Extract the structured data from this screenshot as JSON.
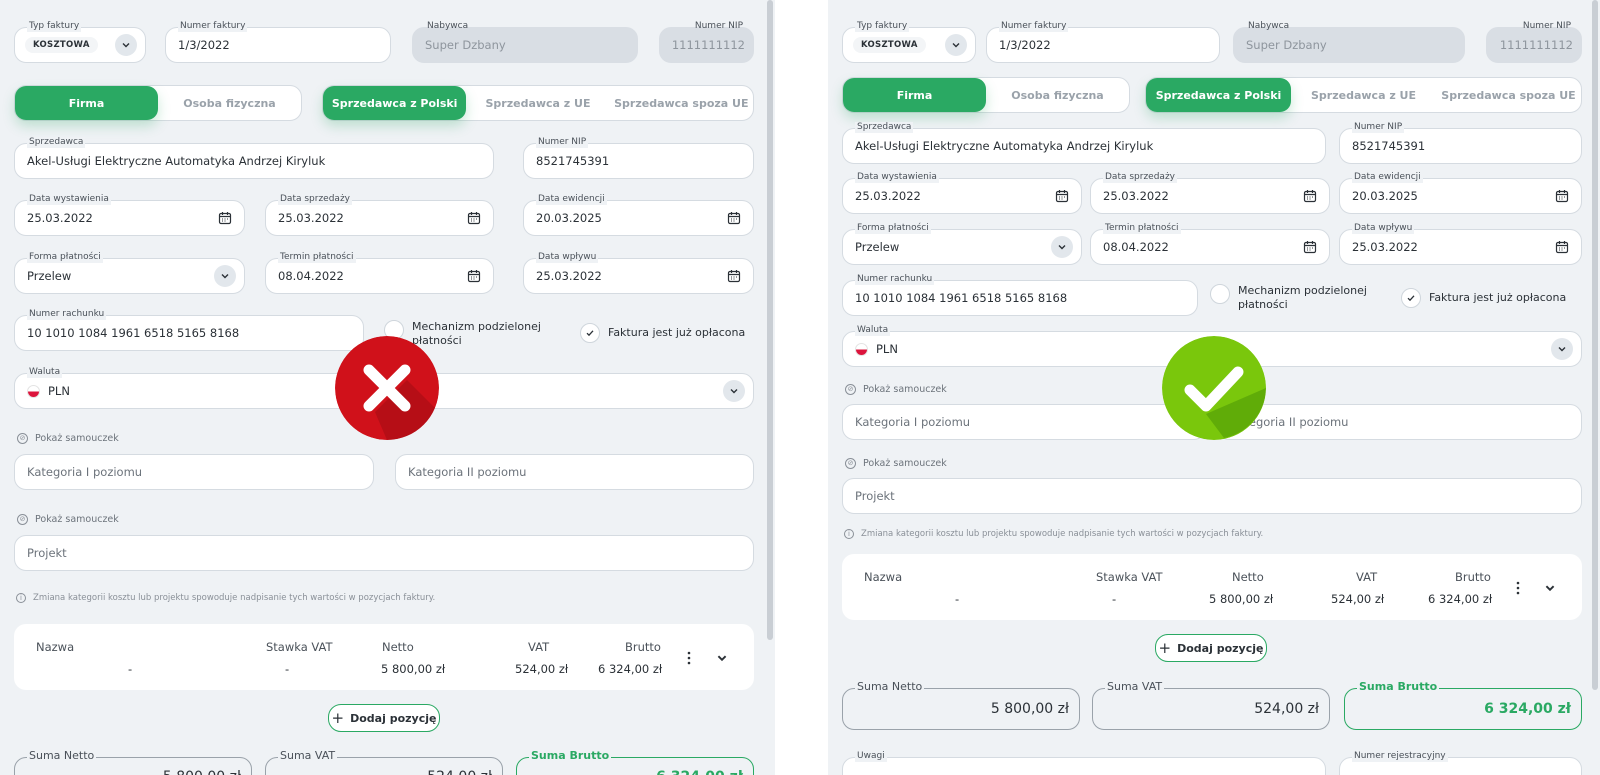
{
  "form": {
    "typ_faktury": {
      "label": "Typ faktury",
      "value": "KOSZTOWA"
    },
    "numer_faktury": {
      "label": "Numer faktury",
      "value": "1/3/2022"
    },
    "nabywca": {
      "label": "Nabywca",
      "value": "Super Dzbany"
    },
    "nip_nabywcy": {
      "label": "Numer NIP",
      "value": "1111111112"
    },
    "entity_toggle": [
      "Firma",
      "Osoba fizyczna"
    ],
    "seller_toggle": [
      "Sprzedawca z Polski",
      "Sprzedawca z UE",
      "Sprzedawca spoza UE"
    ],
    "sprzedawca": {
      "label": "Sprzedawca",
      "value": "Akel-Usługi Elektryczne Automatyka Andrzej Kiryluk"
    },
    "nip_sprzedawcy": {
      "label": "Numer NIP",
      "value": "8521745391"
    },
    "data_wystawienia": {
      "label": "Data wystawienia",
      "value": "25.03.2022"
    },
    "data_sprzedazy": {
      "label": "Data sprzedaży",
      "value": "25.03.2022"
    },
    "data_ewidencji": {
      "label": "Data ewidencji",
      "value": "20.03.2025"
    },
    "forma_platnosci": {
      "label": "Forma płatności",
      "value": "Przelew"
    },
    "termin_platnosci": {
      "label": "Termin płatności",
      "value": "08.04.2022"
    },
    "data_wplywu": {
      "label": "Data wpływu",
      "value": "25.03.2022"
    },
    "numer_rachunku": {
      "label": "Numer rachunku",
      "value": "10 1010 1084 1961 6518 5165 8168"
    },
    "mpp": {
      "line1": "Mechanizm podzielonej",
      "line2": "płatności"
    },
    "oplacona": "Faktura jest już opłacona",
    "waluta": {
      "label": "Waluta",
      "value": "PLN"
    },
    "pokaz_samouczek": "Pokaż samouczek",
    "kategoria_1": "Kategoria I poziomu",
    "kategoria_2": "Kategoria II poziomu",
    "projekt": "Projekt",
    "note": "Zmiana kategorii kosztu lub projektu spowoduje nadpisanie tych wartości w pozycjach faktury.",
    "table": {
      "headers": [
        "Nazwa",
        "Stawka VAT",
        "Netto",
        "VAT",
        "Brutto"
      ],
      "row": [
        "-",
        "-",
        "5 800,00 zł",
        "524,00 zł",
        "6 324,00 zł"
      ]
    },
    "add_position": "Dodaj pozycję",
    "suma_netto": {
      "label": "Suma Netto",
      "value": "5 800,00 zł"
    },
    "suma_vat": {
      "label": "Suma VAT",
      "value": "524,00 zł"
    },
    "suma_brutto": {
      "label": "Suma Brutto",
      "value": "6 324,00 zł"
    },
    "uwagi": "Uwagi",
    "numer_rejestracyjny": "Numer rejestracyjny"
  },
  "colors": {
    "accent": "#2aa963",
    "wrong": "#d0111a",
    "right": "#7ac70c"
  },
  "icons": {
    "wrong": "x-mark-icon",
    "right": "check-mark-icon"
  }
}
